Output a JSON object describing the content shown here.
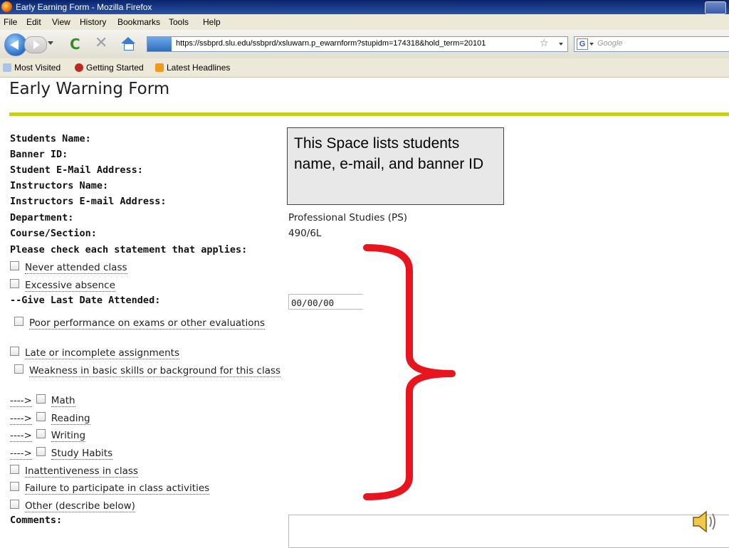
{
  "window": {
    "title": "Early Earning Form - Mozilla Firefox"
  },
  "menu": {
    "file": "File",
    "edit": "Edit",
    "view": "View",
    "history": "History",
    "bookmarks": "Bookmarks",
    "tools": "Tools",
    "help": "Help"
  },
  "nav": {
    "url": "https://ssbprd.slu.edu/ssbprd/xsluwarn.p_ewarnform?stupidm=174318&hold_term=20101",
    "search_placeholder": "Google",
    "search_engine": "G"
  },
  "bookmarks": [
    "Most Visited",
    "Getting Started",
    "Latest Headlines"
  ],
  "page": {
    "title": "Early Warning Form"
  },
  "form": {
    "labels": {
      "student_name": "Students Name:",
      "banner_id": "Banner ID:",
      "student_email": "Student E-Mail Address:",
      "instructor_name": "Instructors Name:",
      "instructor_email": "Instructors E-mail Address:",
      "department": "Department:",
      "course_section": "Course/Section:",
      "check_prompt": "Please check each statement that applies:",
      "last_date": "--Give Last Date Attended:",
      "comments": "Comments:"
    },
    "values": {
      "department": "Professional Studies (PS)",
      "course_section": "490/6L",
      "last_date": "00/00/00"
    },
    "checks": {
      "never_attended": "Never attended class",
      "excessive_absence": "Excessive absence",
      "poor_performance": "Poor performance on exams or other evaluations",
      "late_assignments": "Late or incomplete assignments",
      "weakness": "Weakness in basic skills or background for this class",
      "arrow": "---->",
      "math": "Math",
      "reading": "Reading",
      "writing": "Writing",
      "study_habits": "Study Habits",
      "inattentiveness": "Inattentiveness in class",
      "failure_participate": "Failure to participate in class activities",
      "other": "Other (describe below)"
    }
  },
  "callout": {
    "text": "This Space lists students name, e-mail, and banner ID"
  },
  "colors": {
    "title_rule": "#c8cf1c",
    "brace": "#e8141e",
    "titlebar": "#0a246a"
  }
}
